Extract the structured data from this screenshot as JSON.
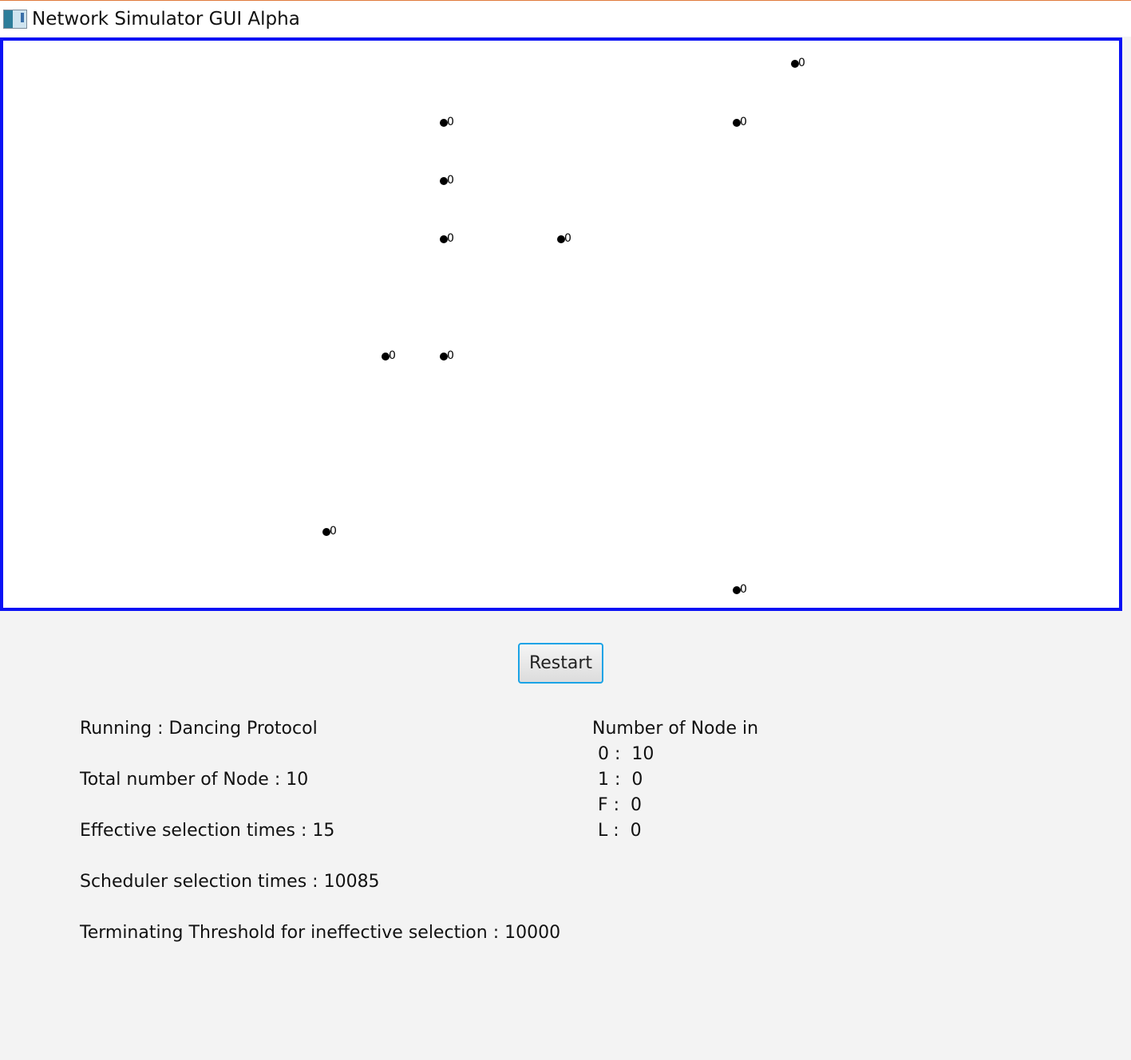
{
  "window": {
    "title": "Network Simulator GUI Alpha"
  },
  "canvas": {
    "nodes": [
      {
        "label": "0"
      },
      {
        "label": "0"
      },
      {
        "label": "0"
      },
      {
        "label": "0"
      },
      {
        "label": "0"
      },
      {
        "label": "0"
      },
      {
        "label": "0"
      },
      {
        "label": "0"
      },
      {
        "label": "0"
      },
      {
        "label": "0"
      }
    ]
  },
  "controls": {
    "restart_label": "Restart"
  },
  "stats": {
    "running": "Running : Dancing Protocol",
    "total_nodes": "Total number of Node : 10",
    "effective_selection": "Effective selection times :  15",
    "scheduler_selection": "Scheduler selection times :  10085",
    "threshold": "Terminating Threshold for ineffective selection : 10000"
  },
  "node_counts": {
    "heading": "Number of Node in",
    "rows": [
      " 0 :  10",
      " 1 :  0",
      " F :  0",
      " L :  0"
    ]
  }
}
